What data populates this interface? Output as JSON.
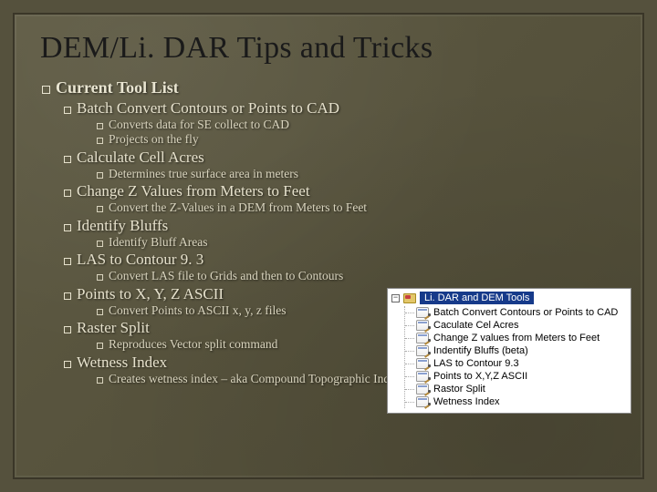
{
  "title": "DEM/Li. DAR Tips and Tricks",
  "h1": "Current Tool List",
  "tools": [
    {
      "name": "Batch Convert Contours or Points to CAD",
      "subs": [
        "Converts data for SE collect to CAD",
        "Projects on the fly"
      ]
    },
    {
      "name": "Calculate Cell Acres",
      "subs": [
        "Determines true surface area in meters"
      ]
    },
    {
      "name": "Change Z Values from Meters to Feet",
      "subs": [
        "Convert the Z-Values in a DEM from Meters to Feet"
      ]
    },
    {
      "name": "Identify Bluffs",
      "subs": [
        "Identify Bluff Areas"
      ]
    },
    {
      "name": "LAS to Contour 9. 3",
      "subs": [
        "Convert LAS file to Grids and then to Contours"
      ]
    },
    {
      "name": "Points to X, Y, Z ASCII",
      "subs": [
        "Convert Points to ASCII x, y, z files"
      ]
    },
    {
      "name": "Raster Split",
      "subs": [
        "Reproduces Vector split command"
      ]
    },
    {
      "name": "Wetness Index",
      "subs": [
        "Creates wetness index – aka Compound Topographic Index"
      ]
    }
  ],
  "toolbox": {
    "root": "Li. DAR and DEM Tools",
    "items": [
      "Batch Convert Contours or Points to CAD",
      "Caculate Cel Acres",
      "Change Z values from Meters to Feet",
      "Indentify Bluffs (beta)",
      "LAS to Contour 9.3",
      "Points to X,Y,Z ASCII",
      "Rastor Split",
      "Wetness Index"
    ]
  }
}
